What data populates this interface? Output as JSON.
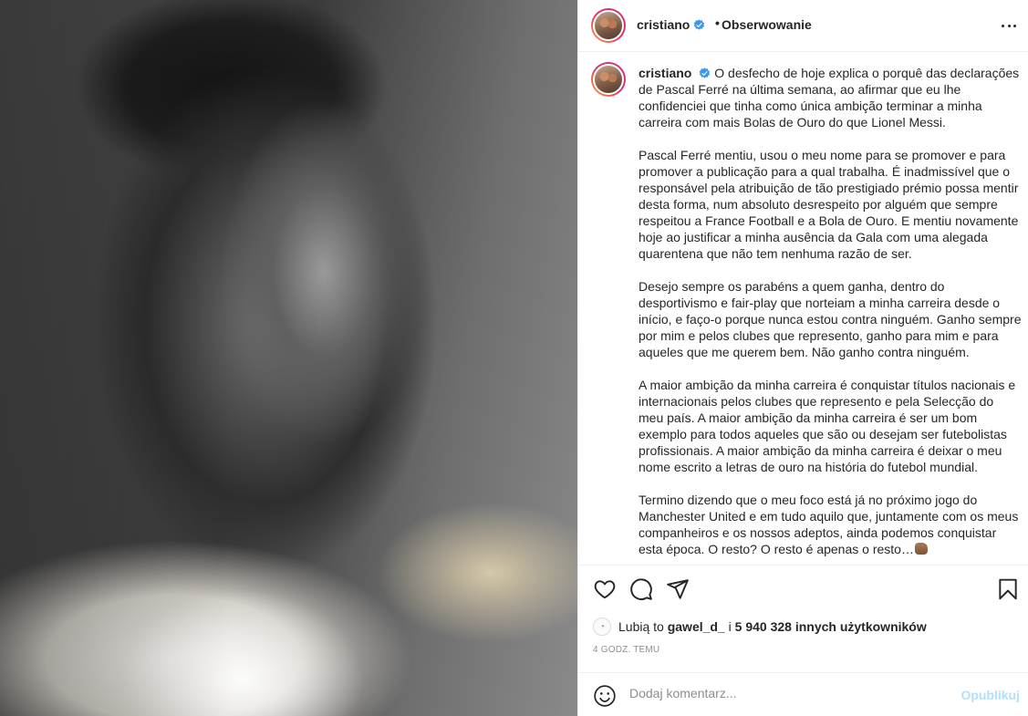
{
  "post": {
    "username": "cristiano",
    "follow_separator": "•",
    "follow_state": "Obserwowanie",
    "caption_paragraphs": [
      "O desfecho de hoje explica o porquê das declarações de Pascal Ferré na última semana, ao afirmar que eu lhe confidenciei que tinha como única ambição terminar a minha carreira com mais Bolas de Ouro do que Lionel Messi.",
      "Pascal Ferré mentiu, usou o meu nome para se promover e para promover a publicação para a qual trabalha. É inadmissível que o responsável pela atribuição de tão prestigiado prémio possa mentir desta forma, num absoluto desrespeito por alguém que sempre respeitou a France Football e a Bola de Ouro. E mentiu novamente hoje ao justificar a minha ausência da Gala com uma alegada quarentena que não tem nenhuma razão de ser.",
      "Desejo sempre os parabéns a quem ganha, dentro do desportivismo e fair-play que norteiam a minha carreira desde o início, e faço-o porque nunca estou contra ninguém. Ganho sempre por mim e pelos clubes que represento, ganho para mim e para aqueles que me querem bem. Não ganho contra ninguém.",
      "A maior ambição da minha carreira é conquistar títulos nacionais e internacionais pelos clubes que represento e pela Selecção do meu país. A maior ambição da minha carreira é ser um bom exemplo para todos aqueles que são ou desejam ser futebolistas profissionais. A maior ambição da minha carreira é deixar o meu nome escrito a letras de ouro na história do futebol mundial.",
      "Termino dizendo que o meu foco está já no próximo jogo do Manchester United e em tudo aquilo que, juntamente com os meus companheiros e os nossos adeptos, ainda podemos conquistar esta época. O resto? O resto é apenas o resto…"
    ],
    "likes": {
      "prefix": "Lubią to",
      "first_user": "gawel_d_",
      "joiner": "i",
      "others": "5 940 328 innych użytkowników"
    },
    "timestamp": "4 GODZ. TEMU",
    "comment_placeholder": "Dodaj komentarz...",
    "publish_label": "Opublikuj"
  },
  "icons": {
    "verified": "verified-badge-icon",
    "more": "more-options-icon",
    "like": "heart-icon",
    "comment": "comment-icon",
    "share": "share-icon",
    "save": "bookmark-icon",
    "emoji": "smiley-icon"
  },
  "colors": {
    "verified": "#3897f0",
    "publish_disabled": "#b2dffc",
    "muted_text": "#8e8e8e"
  }
}
